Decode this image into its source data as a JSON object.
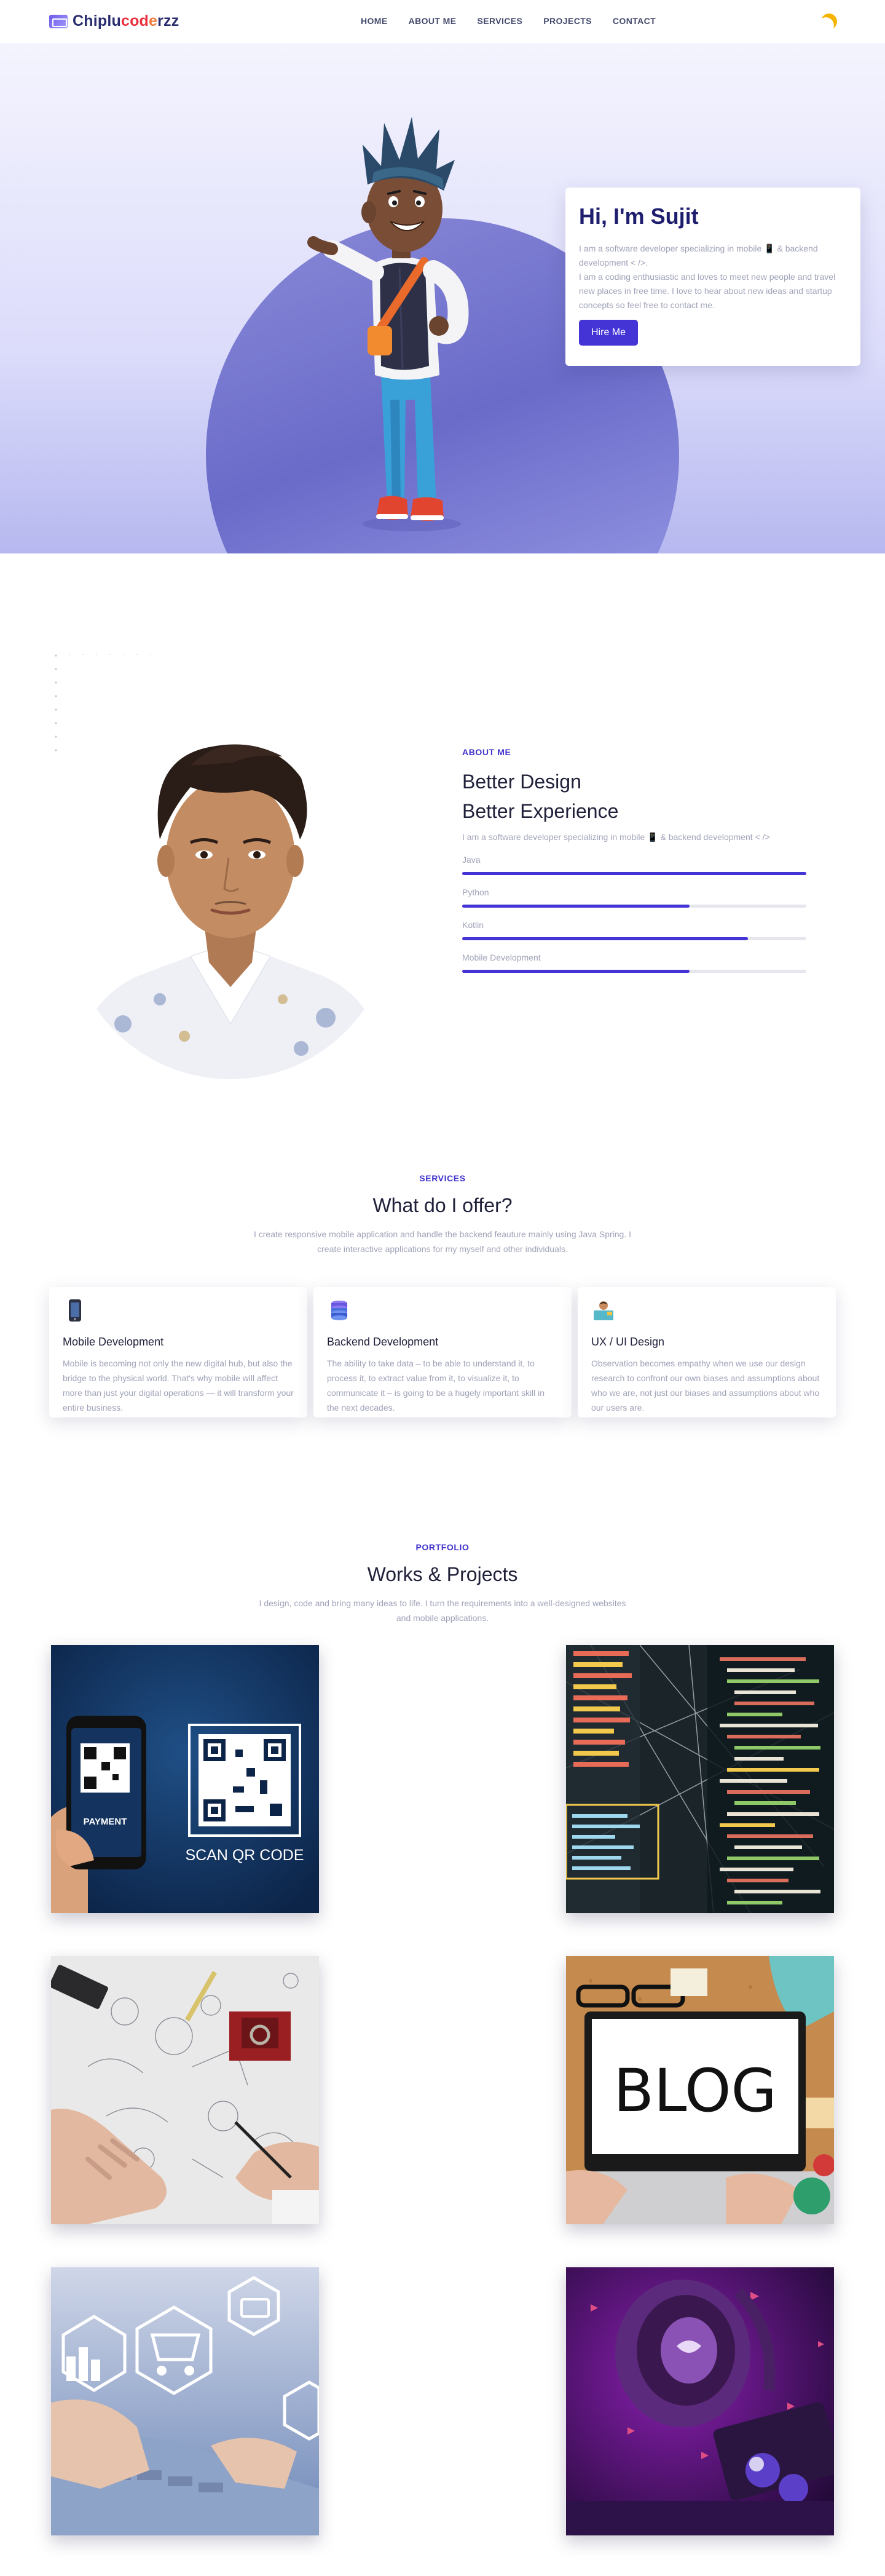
{
  "nav": {
    "brand_main": "Chiplu",
    "brand_accent": "cod",
    "brand_accent2": "e",
    "brand_tail": "rzz",
    "links": [
      "HOME",
      "ABOUT ME",
      "SERVICES",
      "PROJECTS",
      "CONTACT"
    ],
    "theme_icon": "moon-icon"
  },
  "hero": {
    "title": "Hi, I'm Sujit",
    "line1": "I am a software developer specializing in mobile 📱 & backend development < />.",
    "line2": "I am a coding enthusiastic and loves to meet new people and travel new places in free time. I love to hear about new ideas and startup concepts so feel free to contact me.",
    "cta": "Hire Me"
  },
  "about": {
    "eyebrow": "ABOUT ME",
    "heading1": "Better Design",
    "heading2": "Better Experience",
    "subtitle": "I am a software developer specializing in mobile 📱 & backend development < />",
    "skills": [
      {
        "name": "Java",
        "level": 1.0
      },
      {
        "name": "Python",
        "level": 0.66
      },
      {
        "name": "Kotlin",
        "level": 0.83
      },
      {
        "name": "Mobile Development",
        "level": 0.66
      }
    ]
  },
  "services": {
    "eyebrow": "SERVICES",
    "heading": "What do I offer?",
    "description": "I create responsive mobile application and handle the backend feauture mainly using Java Spring. I create interactive applications for my myself and other individuals.",
    "cards": [
      {
        "icon": "smartphone-icon",
        "title": "Mobile Development",
        "text": "Mobile is becoming not only the new digital hub, but also the bridge to the physical world. That's why mobile will affect more than just your digital operations — it will transform your entire business."
      },
      {
        "icon": "database-icon",
        "title": "Backend Development",
        "text": "The ability to take data – to be able to understand it, to process it, to extract value from it, to visualize it, to communicate it – is going to be a hugely important skill in the next decades."
      },
      {
        "icon": "designer-icon",
        "title": "UX / UI Design",
        "text": "Observation becomes empathy when we use our design research to confront our own biases and assumptions about who we are, not just our biases and assumptions about who our users are."
      }
    ]
  },
  "portfolio": {
    "eyebrow": "PORTFOLIO",
    "heading": "Works & Projects",
    "description": "I design, code and bring many ideas to life. I turn the requirements into a well-designed websites and mobile applications.",
    "qr_payment": "PAYMENT",
    "qr_caption": "SCAN QR CODE",
    "blog_word": "BLOG"
  },
  "colors": {
    "primary": "#4434d6",
    "navy": "#1f1e6e",
    "muted": "#a0a3b8",
    "accent_red": "#e8303d"
  }
}
